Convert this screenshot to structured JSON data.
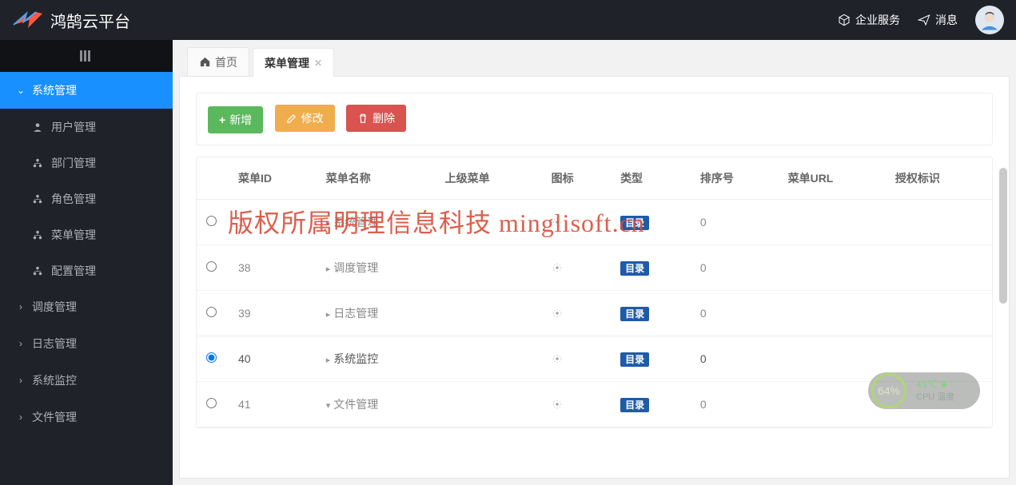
{
  "brand": {
    "name": "鸿鹄云平台"
  },
  "header": {
    "enterprise": "企业服务",
    "messages": "消息"
  },
  "sidebar": {
    "groups": [
      {
        "label": "系统管理",
        "open": true,
        "items": [
          {
            "icon": "user",
            "label": "用户管理"
          },
          {
            "icon": "sitemap",
            "label": "部门管理"
          },
          {
            "icon": "sitemap",
            "label": "角色管理"
          },
          {
            "icon": "sitemap",
            "label": "菜单管理"
          },
          {
            "icon": "sitemap",
            "label": "配置管理"
          }
        ]
      },
      {
        "label": "调度管理",
        "open": false
      },
      {
        "label": "日志管理",
        "open": false
      },
      {
        "label": "系统监控",
        "open": false
      },
      {
        "label": "文件管理",
        "open": false
      }
    ]
  },
  "tabs": [
    {
      "label": "首页",
      "home": true
    },
    {
      "label": "菜单管理",
      "active": true,
      "closable": true
    }
  ],
  "toolbar": {
    "add": "新增",
    "edit": "修改",
    "del": "删除"
  },
  "table": {
    "headers": [
      "菜单ID",
      "菜单名称",
      "上级菜单",
      "图标",
      "类型",
      "排序号",
      "菜单URL",
      "授权标识"
    ],
    "rows": [
      {
        "id": "1",
        "name": "系统管理",
        "parent": "",
        "icon": "gear",
        "type": "目录",
        "sort": "0",
        "url": "",
        "auth": "",
        "expand": "right",
        "selected": false
      },
      {
        "id": "38",
        "name": "调度管理",
        "parent": "",
        "icon": "gear",
        "type": "目录",
        "sort": "0",
        "url": "",
        "auth": "",
        "expand": "right",
        "selected": false
      },
      {
        "id": "39",
        "name": "日志管理",
        "parent": "",
        "icon": "gear",
        "type": "目录",
        "sort": "0",
        "url": "",
        "auth": "",
        "expand": "right",
        "selected": false
      },
      {
        "id": "40",
        "name": "系统监控",
        "parent": "",
        "icon": "gear",
        "type": "目录",
        "sort": "0",
        "url": "",
        "auth": "",
        "expand": "right",
        "selected": true
      },
      {
        "id": "41",
        "name": "文件管理",
        "parent": "",
        "icon": "gear",
        "type": "目录",
        "sort": "0",
        "url": "",
        "auth": "",
        "expand": "down",
        "selected": false
      }
    ]
  },
  "widget": {
    "pct": "64%",
    "temp": "43℃",
    "label": "CPU 温度"
  },
  "watermark": "版权所属明理信息科技 minglisoft.cn"
}
